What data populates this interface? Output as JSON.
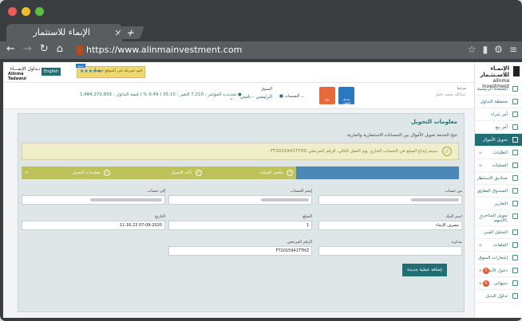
{
  "browser": {
    "tab_title": "الإنماء للاستثمار",
    "tab_close": "×",
    "new_tab": "+",
    "url": "https://www.alinmainvestment.com",
    "colors": {
      "close": "#ee5b55",
      "minimize": "#f2bc32",
      "maximize": "#58c13e"
    }
  },
  "header": {
    "logo_ar": "تـداول الإنمـــاء",
    "logo_en": "Alinma Tadawul",
    "language_button": "English",
    "promo_text": "قيم تجربتك في الموقع جديداً",
    "promo_stars": "★★★★★",
    "promo_badge": "جديد"
  },
  "ticker": {
    "summary": "● متذبذب  المؤشر : 7,210  التغير : 35.15 ( 0.49 % )  قيمة التداول : 1,484,272,855",
    "market_label": "السوق",
    "market_value": "الرئيسي - تاسي",
    "ratings_label": "التقييمات",
    "user_label": "مرحبا",
    "user_name": "عبدالله سعيد خليل",
    "btn1": "تعديل الطلب",
    "btn2": "يوم"
  },
  "sidebar": {
    "brand_ar": "الإنمـاء للاسـتثـمار",
    "brand_en": "alinma investment",
    "items": [
      {
        "label": "الصفحة الرئيسية"
      },
      {
        "label": "محفظة التداول"
      },
      {
        "label": "أمر شراء"
      },
      {
        "label": "أمر بيع"
      },
      {
        "label": "تحويل الأموال"
      },
      {
        "label": "الطلبات"
      },
      {
        "label": "العمليات"
      },
      {
        "label": "صناديق الاستثمار"
      },
      {
        "label": "الصندوق العقاري"
      },
      {
        "label": "التقارير"
      },
      {
        "label": "تمويل المتاجرة بالأسهم"
      },
      {
        "label": "التحليل الفني"
      },
      {
        "label": "الملفات"
      },
      {
        "label": "إشعارات السوق"
      },
      {
        "label": "دخول الأنظمة"
      },
      {
        "label": "تنبيهاتي"
      },
      {
        "label": "تداول البديل"
      }
    ],
    "badge1": "3",
    "badge2": "6"
  },
  "content": {
    "title": "معلومات التحويل",
    "subtitle": "تتيح الخدمة تحويل الأموال بين الحسابات الاستثمارية والجارية.",
    "notice": "سيتم إيداع المبلغ في الحساب الجاري يوم العمل التالي. الرقم المرجعي FT2015941TTHZ -",
    "steps": [
      "معلومات التحويل",
      "تأكيد التحويل",
      "ملخص العملية"
    ],
    "fields": {
      "from_account_label": "من حساب",
      "account_name_label": "إسم الحساب",
      "to_account_label": "إلى حساب",
      "bank_name_label": "اسم البنك",
      "bank_name_value": "مصرف الإنماء",
      "amount_label": "المبلغ",
      "amount_value": "1",
      "date_label": "التاريخ",
      "date_value": "11:16:23 07-09-2020",
      "notes_label": "مذكره",
      "ref_label": "الرقم المرجعي",
      "ref_value": "FT2015941TTHZ"
    },
    "submit": "إضافة عملية جديدة"
  }
}
